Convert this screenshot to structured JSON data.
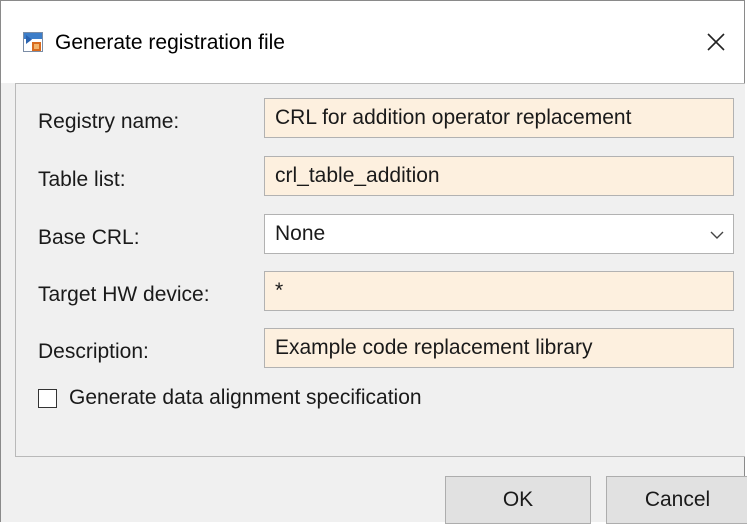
{
  "window": {
    "title": "Generate registration file"
  },
  "form": {
    "registry_name": {
      "label": "Registry name:",
      "value": "CRL for addition operator replacement"
    },
    "table_list": {
      "label": "Table list:",
      "value": "crl_table_addition"
    },
    "base_crl": {
      "label": "Base CRL:",
      "value": "None"
    },
    "target_hw_device": {
      "label": "Target HW device:",
      "value": "*"
    },
    "description": {
      "label": "Description:",
      "value": "Example code replacement library"
    },
    "data_alignment": {
      "label": "Generate data alignment specification",
      "checked": false
    }
  },
  "buttons": {
    "ok": "OK",
    "cancel": "Cancel"
  },
  "colors": {
    "field_background": "#fdf0df",
    "dialog_background": "#f0f0f0",
    "button_background": "#e1e1e1"
  },
  "icons": {
    "app": "matlab-app-icon",
    "close": "close-icon",
    "dropdown": "chevron-down-icon"
  }
}
